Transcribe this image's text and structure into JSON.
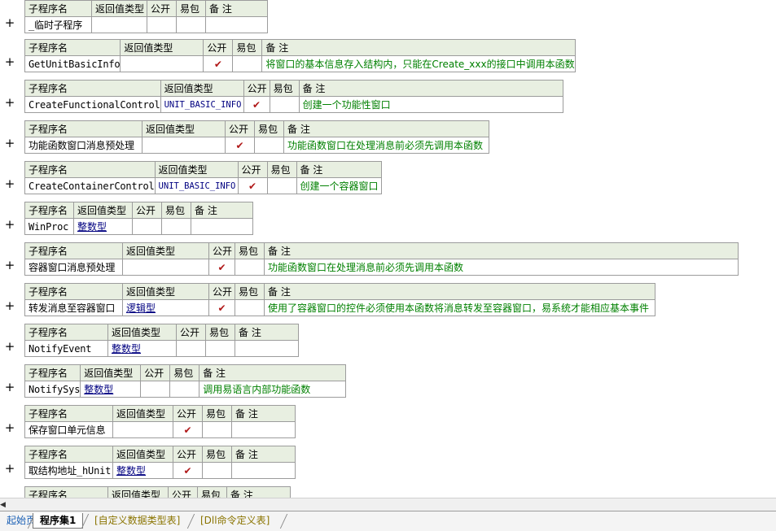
{
  "headers": {
    "name": "子程序名",
    "ret": "返回值类型",
    "pub": "公开",
    "easy": "易包",
    "remark": "备 注"
  },
  "expand_symbol": "+",
  "check_mark": "✔",
  "rows": [
    {
      "name": "_临时子程序",
      "type": "",
      "pub": false,
      "remark": ""
    },
    {
      "name": "GetUnitBasicInfo",
      "type": "",
      "pub": true,
      "remark": "将窗口的基本信息存入结构内，只能在Create_xxx的接口中调用本函数"
    },
    {
      "name": "CreateFunctionalControl",
      "type": "UNIT_BASIC_INFO",
      "pub": true,
      "remark": "创建一个功能性窗口"
    },
    {
      "name": "功能函数窗口消息预处理",
      "type": "",
      "pub": true,
      "remark": "功能函数窗口在处理消息前必须先调用本函数"
    },
    {
      "name": "CreateContainerControl",
      "type": "UNIT_BASIC_INFO",
      "pub": true,
      "remark": "创建一个容器窗口"
    },
    {
      "name": "WinProc",
      "type": "整数型",
      "pub": false,
      "remark": ""
    },
    {
      "name": "容器窗口消息预处理",
      "type": "",
      "pub": true,
      "remark": "功能函数窗口在处理消息前必须先调用本函数"
    },
    {
      "name": "转发消息至容器窗口",
      "type": "逻辑型",
      "pub": true,
      "remark": "使用了容器窗口的控件必须使用本函数将消息转发至容器窗口，易系统才能相应基本事件"
    },
    {
      "name": "NotifyEvent",
      "type": "整数型",
      "pub": false,
      "remark": ""
    },
    {
      "name": "NotifySys",
      "type": "整数型",
      "pub": false,
      "remark": "调用易语言内部功能函数"
    },
    {
      "name": "保存窗口单元信息",
      "type": "",
      "pub": true,
      "remark": ""
    },
    {
      "name": "取结构地址_hUnit",
      "type": "整数型",
      "pub": true,
      "remark": ""
    },
    {
      "name": "",
      "type": "",
      "pub": false,
      "remark": ""
    }
  ],
  "scroll_arrow": "◀",
  "tabs": [
    "起始页",
    "程序集1",
    "[自定义数据类型表]",
    "[Dll命令定义表]"
  ]
}
